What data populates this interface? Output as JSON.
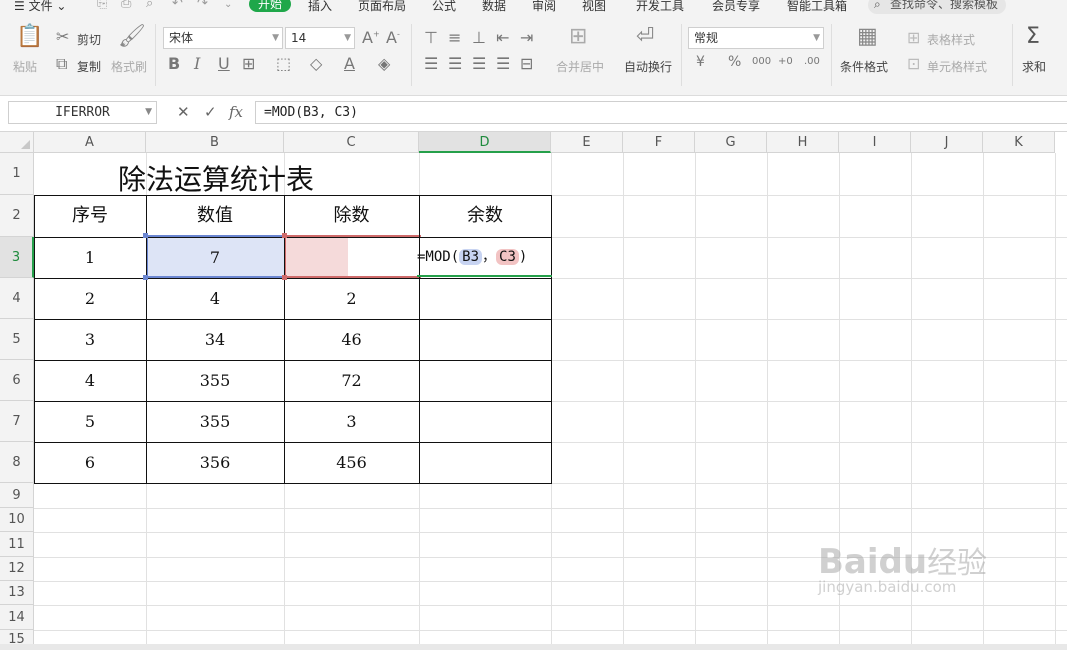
{
  "menubar": {
    "file_label": "☰ 文件 ⌄",
    "tabs": [
      "开始",
      "插入",
      "页面布局",
      "公式",
      "数据",
      "审阅",
      "视图",
      "开发工具",
      "会员专享",
      "智能工具箱"
    ],
    "search_placeholder": "查找命令、搜索模板"
  },
  "ribbon": {
    "paste_label": "粘贴",
    "cut_label": "剪切",
    "copy_label": "复制",
    "format_painter_label": "格式刷",
    "font_name": "宋体",
    "font_size": "14",
    "merge_label": "合并居中",
    "wrap_label": "自动换行",
    "number_format": "常规",
    "cond_format_label": "条件格式",
    "table_style_label": "表格样式",
    "cell_style_label": "单元格样式",
    "sum_label": "求和",
    "currency_symbol": "¥",
    "percent_symbol": "%",
    "thousands_symbol": "000",
    "dec_inc_symbol": "+0",
    "dec_dec_symbol": ".00"
  },
  "formula_bar": {
    "name_box": "IFERROR",
    "cancel_symbol": "✕",
    "confirm_symbol": "✓",
    "fx_symbol": "fx",
    "formula": "=MOD(B3, C3)"
  },
  "sheet": {
    "columns": [
      "A",
      "B",
      "C",
      "D",
      "E",
      "F",
      "G",
      "H",
      "I",
      "J",
      "K"
    ],
    "rows": [
      "1",
      "2",
      "3",
      "4",
      "5",
      "6",
      "7",
      "8",
      "9",
      "10",
      "11",
      "12",
      "13",
      "14",
      "15"
    ],
    "title": "除法运算统计表",
    "headers": [
      "序号",
      "数值",
      "除数",
      "余数"
    ],
    "data_rows": [
      [
        "1",
        "7",
        "",
        ""
      ],
      [
        "2",
        "4",
        "2",
        ""
      ],
      [
        "3",
        "34",
        "46",
        ""
      ],
      [
        "4",
        "355",
        "72",
        ""
      ],
      [
        "5",
        "355",
        "3",
        ""
      ],
      [
        "6",
        "356",
        "456",
        ""
      ]
    ],
    "edit_cell": {
      "prefix": "=MOD(",
      "ref1": "B3",
      "sep": "，",
      "ref2": "C3",
      "suffix": ")"
    },
    "active_column": "D",
    "active_row": "3"
  },
  "watermark": {
    "brand": "Bai",
    "brand2": "du",
    "brand_cn": "经验",
    "url": "jingyan.baidu.com"
  },
  "colors": {
    "accent_green": "#1fa74a",
    "ref_blue": "#6b86d1",
    "ref_red": "#cf6b6b"
  }
}
